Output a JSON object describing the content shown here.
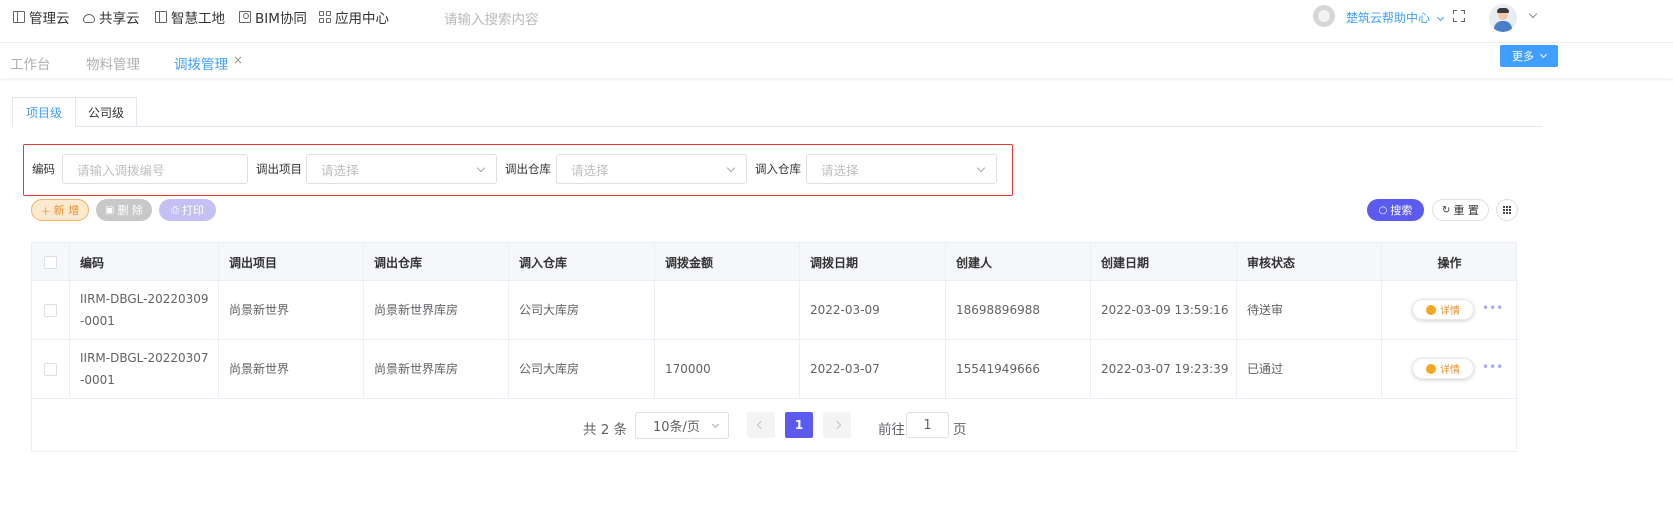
{
  "top_nav": {
    "items": [
      {
        "label": "管理云",
        "icon": "book-icon"
      },
      {
        "label": "共享云",
        "icon": "cloud-icon"
      },
      {
        "label": "智慧工地",
        "icon": "book-icon"
      },
      {
        "label": "BIM协同",
        "icon": "bim-icon"
      },
      {
        "label": "应用中心",
        "icon": "grid-icon"
      }
    ],
    "search_placeholder": "请输入搜索内容",
    "help_label": "楚筑云帮助中心"
  },
  "page_tabs": {
    "items": [
      {
        "label": "工作台",
        "active": false
      },
      {
        "label": "物料管理",
        "active": false
      },
      {
        "label": "调拨管理",
        "active": true
      }
    ],
    "close_symbol": "×",
    "more_label": "更多"
  },
  "level_tabs": [
    {
      "label": "项目级",
      "active": true
    },
    {
      "label": "公司级",
      "active": false
    }
  ],
  "filters": {
    "code_label": "编码",
    "code_placeholder": "请输入调拨编号",
    "out_project_label": "调出项目",
    "out_project_placeholder": "请选择",
    "out_warehouse_label": "调出仓库",
    "out_warehouse_placeholder": "请选择",
    "in_warehouse_label": "调入仓库",
    "in_warehouse_placeholder": "请选择"
  },
  "actions": {
    "add": "新 增",
    "delete": "删 除",
    "print": "打印",
    "search": "搜索",
    "reset": "重 置"
  },
  "table": {
    "headers": [
      "编码",
      "调出项目",
      "调出仓库",
      "调入仓库",
      "调拨金额",
      "调拨日期",
      "创建人",
      "创建日期",
      "审核状态",
      "操作"
    ],
    "rows": [
      {
        "code": "IIRM-DBGL-20220309-0001",
        "out_project": "尚景新世界",
        "out_warehouse": "尚景新世界库房",
        "in_warehouse": "公司大库房",
        "amount": "",
        "date": "2022-03-09",
        "creator": "18698896988",
        "created_at": "2022-03-09 13:59:16",
        "status": "待送审",
        "detail_label": "详情"
      },
      {
        "code": "IIRM-DBGL-20220307-0001",
        "out_project": "尚景新世界",
        "out_warehouse": "尚景新世界库房",
        "in_warehouse": "公司大库房",
        "amount": "170000",
        "date": "2022-03-07",
        "creator": "15541949666",
        "created_at": "2022-03-07 19:23:39",
        "status": "已通过",
        "detail_label": "详情"
      }
    ],
    "more_symbol": "•••"
  },
  "pagination": {
    "total_text": "共 2 条",
    "page_size": "10条/页",
    "current_page": "1",
    "goto_label": "前往",
    "goto_value": "1",
    "goto_unit": "页"
  },
  "colors": {
    "primary": "#409eff",
    "accent_purple": "#5b5bf0",
    "warning_orange": "#e6912d",
    "highlight_red": "#e53935"
  }
}
